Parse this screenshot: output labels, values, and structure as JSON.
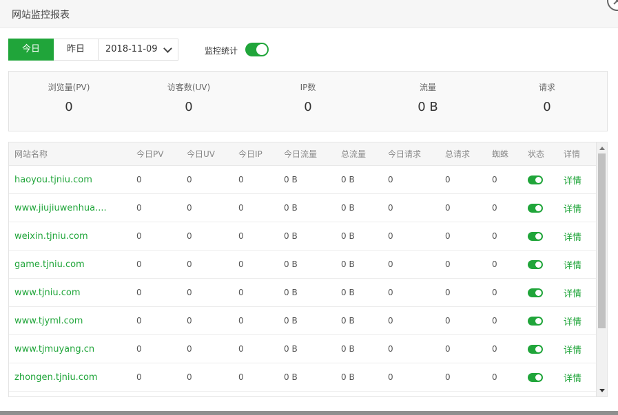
{
  "dialog": {
    "title": "网站监控报表"
  },
  "toolbar": {
    "today": "今日",
    "yesterday": "昨日",
    "date": "2018-11-09",
    "monitor_label": "监控统计",
    "monitor_enabled": true
  },
  "summary": [
    {
      "label": "浏览量(PV)",
      "value": "0"
    },
    {
      "label": "访客数(UV)",
      "value": "0"
    },
    {
      "label": "IP数",
      "value": "0"
    },
    {
      "label": "流量",
      "value": "0 B"
    },
    {
      "label": "请求",
      "value": "0"
    }
  ],
  "table": {
    "headers": [
      "网站名称",
      "今日PV",
      "今日UV",
      "今日IP",
      "今日流量",
      "总流量",
      "今日请求",
      "总请求",
      "蜘蛛",
      "状态",
      "详情"
    ],
    "rows": [
      {
        "site": "haoyou.tjniu.com",
        "pv": "0",
        "uv": "0",
        "ip": "0",
        "flow": "0 B",
        "total_flow": "0 B",
        "req": "0",
        "total_req": "0",
        "spider": "0",
        "status": true,
        "detail": "详情"
      },
      {
        "site": "www.jiujiuwenhua....",
        "pv": "0",
        "uv": "0",
        "ip": "0",
        "flow": "0 B",
        "total_flow": "0 B",
        "req": "0",
        "total_req": "0",
        "spider": "0",
        "status": true,
        "detail": "详情"
      },
      {
        "site": "weixin.tjniu.com",
        "pv": "0",
        "uv": "0",
        "ip": "0",
        "flow": "0 B",
        "total_flow": "0 B",
        "req": "0",
        "total_req": "0",
        "spider": "0",
        "status": true,
        "detail": "详情"
      },
      {
        "site": "game.tjniu.com",
        "pv": "0",
        "uv": "0",
        "ip": "0",
        "flow": "0 B",
        "total_flow": "0 B",
        "req": "0",
        "total_req": "0",
        "spider": "0",
        "status": true,
        "detail": "详情"
      },
      {
        "site": "www.tjniu.com",
        "pv": "0",
        "uv": "0",
        "ip": "0",
        "flow": "0 B",
        "total_flow": "0 B",
        "req": "0",
        "total_req": "0",
        "spider": "0",
        "status": true,
        "detail": "详情"
      },
      {
        "site": "www.tjyml.com",
        "pv": "0",
        "uv": "0",
        "ip": "0",
        "flow": "0 B",
        "total_flow": "0 B",
        "req": "0",
        "total_req": "0",
        "spider": "0",
        "status": true,
        "detail": "详情"
      },
      {
        "site": "www.tjmuyang.cn",
        "pv": "0",
        "uv": "0",
        "ip": "0",
        "flow": "0 B",
        "total_flow": "0 B",
        "req": "0",
        "total_req": "0",
        "spider": "0",
        "status": true,
        "detail": "详情"
      },
      {
        "site": "zhongen.tjniu.com",
        "pv": "0",
        "uv": "0",
        "ip": "0",
        "flow": "0 B",
        "total_flow": "0 B",
        "req": "0",
        "total_req": "0",
        "spider": "0",
        "status": true,
        "detail": "详情"
      }
    ]
  },
  "colors": {
    "accent": "#20a53a"
  },
  "icons": {
    "close": "close-icon",
    "dropdown": "chevron-down-icon"
  }
}
